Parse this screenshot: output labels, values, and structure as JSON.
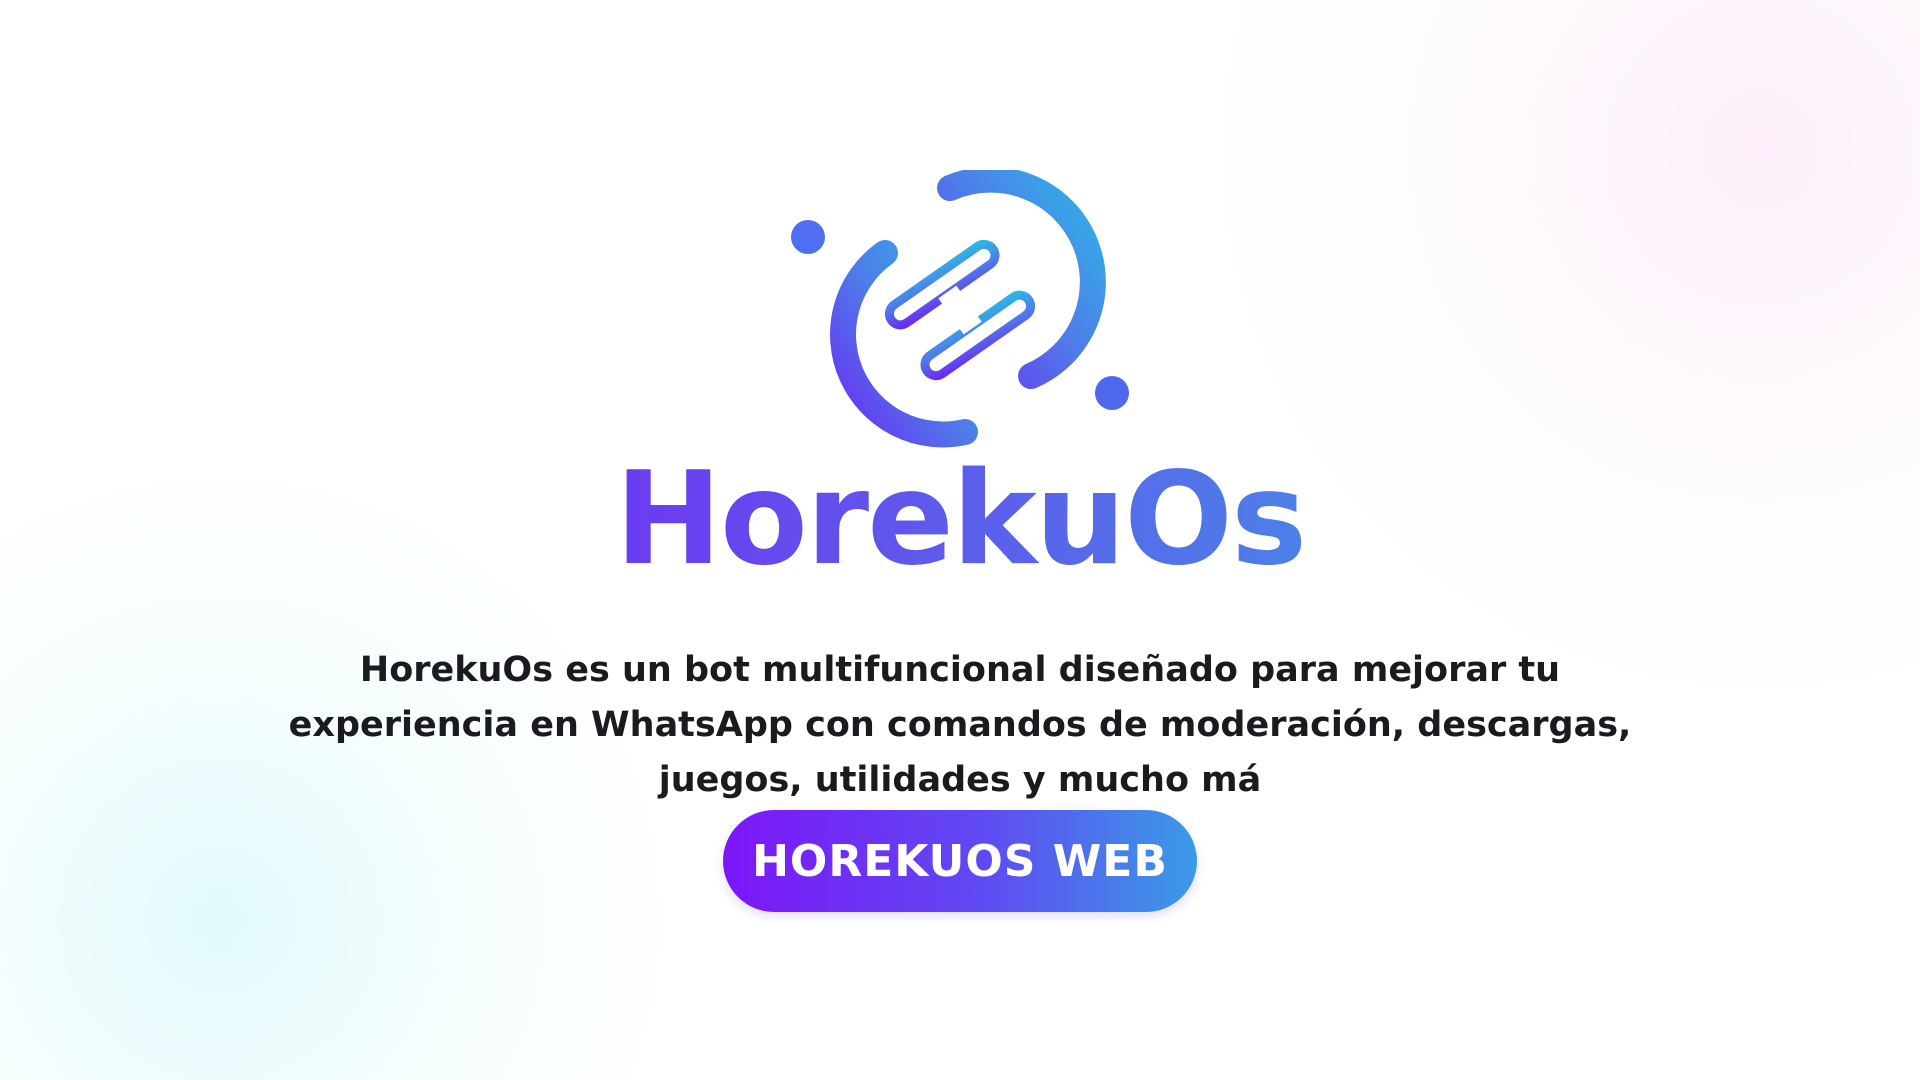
{
  "brand": {
    "name": "HorekuOs",
    "logo_icon": "horekuos-logo-icon",
    "colors": {
      "gradient_start": "#7a1cf5",
      "gradient_mid": "#5f4af2",
      "gradient_end": "#2ec7e0"
    }
  },
  "hero": {
    "description": "HorekuOs es un bot multifuncional diseñado para mejorar tu experiencia en WhatsApp con comandos de moderación, descargas, juegos, utilidades y mucho má"
  },
  "cta": {
    "label": "HOREKUOS WEB"
  }
}
